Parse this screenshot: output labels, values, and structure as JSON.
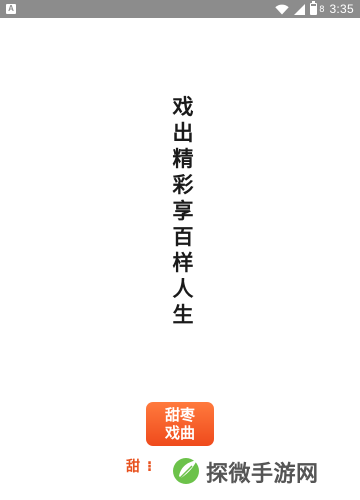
{
  "status_bar": {
    "notification_icon": "A",
    "battery_level": "8",
    "time": "3:35",
    "icons": [
      "notification-icon",
      "wifi-icon",
      "signal-icon",
      "battery-icon"
    ]
  },
  "splash": {
    "slogan_chars": [
      "戏",
      "出",
      "精",
      "彩",
      "享",
      "百",
      "样",
      "人",
      "生"
    ],
    "slogan_color": "#1a1a1a"
  },
  "app_logo": {
    "line1": "甜枣",
    "line2": "戏曲",
    "gradient_top": "#ff7a3d",
    "gradient_bottom": "#ef4a1c"
  },
  "app_name_partial": "甜 ⁝",
  "watermark": {
    "text": "探微手游网",
    "leaf_color": "#6cc24a",
    "text_color": "#555555"
  }
}
